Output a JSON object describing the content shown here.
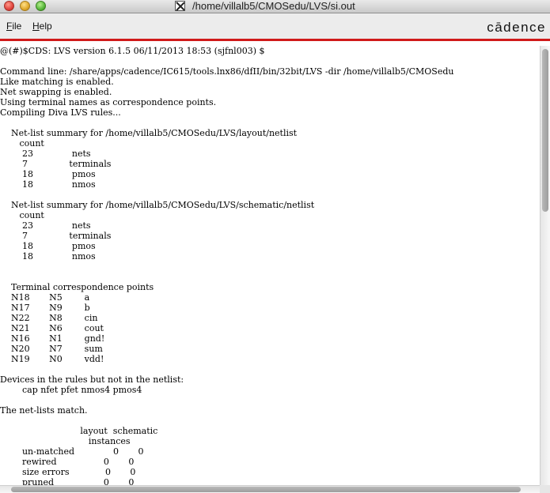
{
  "window": {
    "title": "/home/villalb5/CMOSedu/LVS/si.out"
  },
  "menu": {
    "file_mnemonic": "F",
    "file_rest": "ile",
    "help_mnemonic": "H",
    "help_rest": "elp"
  },
  "brand": {
    "logo_text": "cādence",
    "accent_color": "#d01a1a"
  },
  "output": {
    "lines": [
      "@(#)$CDS: LVS version 6.1.5 06/11/2013 18:53 (sjfnl003) $",
      "",
      "Command line: /share/apps/cadence/IC615/tools.lnx86/dfII/bin/32bit/LVS -dir /home/villalb5/CMOSedu",
      "Like matching is enabled.",
      "Net swapping is enabled.",
      "Using terminal names as correspondence points.",
      "Compiling Diva LVS rules...",
      "",
      "    Net-list summary for /home/villalb5/CMOSedu/LVS/layout/netlist",
      "       count",
      "        23              nets",
      "        7               terminals",
      "        18              pmos",
      "        18              nmos",
      "",
      "    Net-list summary for /home/villalb5/CMOSedu/LVS/schematic/netlist",
      "       count",
      "        23              nets",
      "        7               terminals",
      "        18              pmos",
      "        18              nmos",
      "",
      "",
      "    Terminal correspondence points",
      "    N18       N5        a",
      "    N17       N9        b",
      "    N22       N8        cin",
      "    N21       N6        cout",
      "    N16       N1        gnd!",
      "    N20       N7        sum",
      "    N19       N0        vdd!",
      "",
      "Devices in the rules but not in the netlist:",
      "        cap nfet pfet nmos4 pmos4",
      "",
      "The net-lists match.",
      "",
      "                             layout  schematic",
      "                                instances",
      "        un-matched              0       0",
      "        rewired                 0       0",
      "        size errors             0       0",
      "        pruned                  0       0"
    ]
  }
}
